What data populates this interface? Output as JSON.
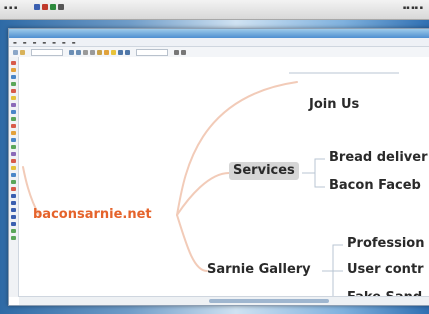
{
  "mindmap": {
    "root": "baconsarnie.net",
    "branches": [
      {
        "label": "Join Us",
        "children": []
      },
      {
        "label": "Services",
        "children": [
          "Bread deliver",
          "Bacon Faceb"
        ]
      },
      {
        "label": "Sarnie Gallery",
        "children": [
          "Profession",
          "User contr",
          "Fake Sand"
        ]
      }
    ]
  },
  "colors": {
    "root_text": "#e5632b",
    "link_line": "#f2cbb8",
    "selected_node_bg": "#d6d6d6"
  }
}
